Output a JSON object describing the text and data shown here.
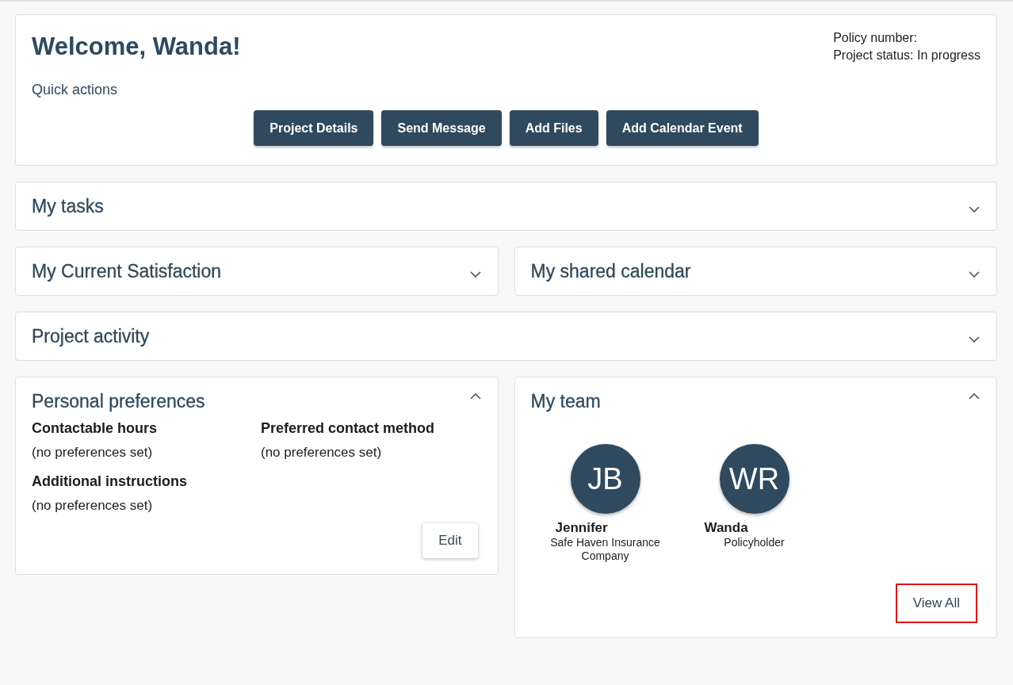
{
  "welcome": {
    "title": "Welcome, Wanda!",
    "info": [
      "Policy number:",
      "Project status: In progress"
    ],
    "quick_actions_label": "Quick actions",
    "buttons": [
      "Project Details",
      "Send Message",
      "Add Files",
      "Add Calendar Event"
    ]
  },
  "rows": [
    {
      "panels": [
        {
          "title": "My tasks",
          "expanded": false
        }
      ]
    },
    {
      "panels": [
        {
          "title": "My Current Satisfaction",
          "expanded": false
        },
        {
          "title": "My shared calendar",
          "expanded": false
        }
      ]
    },
    {
      "panels": [
        {
          "title": "Project activity",
          "expanded": false
        }
      ]
    },
    {
      "panels": [
        {
          "kind": "preferences",
          "title": "Personal preferences",
          "expanded": true,
          "fields": [
            {
              "label": "Contactable hours",
              "value": "(no preferences set)"
            },
            {
              "label": "Preferred contact method",
              "value": "(no preferences set)"
            },
            {
              "label": "Additional instructions",
              "value": "(no preferences set)"
            }
          ],
          "edit_button": "Edit"
        },
        {
          "kind": "team",
          "title": "My team",
          "expanded": true,
          "members": [
            {
              "initials": "JB",
              "name": "Jennifer",
              "role": "Safe Haven Insurance Company"
            },
            {
              "initials": "WR",
              "name": "Wanda",
              "role": "Policyholder"
            }
          ],
          "view_all": {
            "label": "View All",
            "highlighted": true
          }
        }
      ]
    }
  ]
}
